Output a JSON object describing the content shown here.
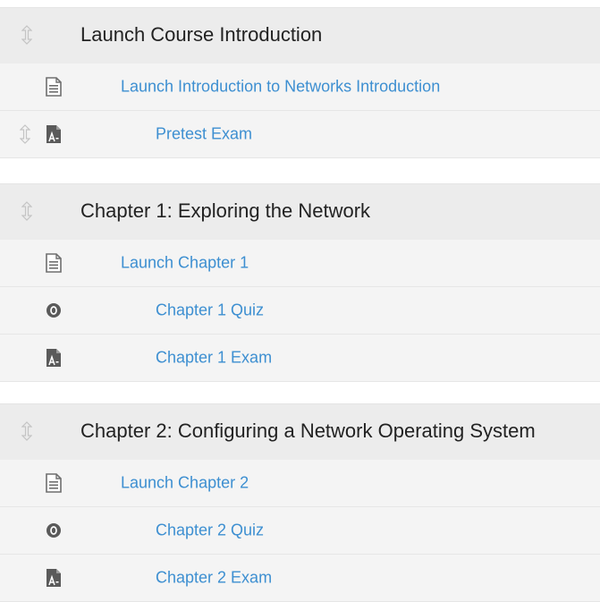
{
  "modules": [
    {
      "title": "Launch Course Introduction",
      "items": [
        {
          "label": "Launch Introduction to Networks Introduction",
          "icon": "document-icon"
        },
        {
          "label": "Pretest Exam",
          "icon": "assessment-icon"
        }
      ]
    },
    {
      "title": "Chapter 1: Exploring the Network",
      "items": [
        {
          "label": "Launch Chapter 1",
          "icon": "document-icon"
        },
        {
          "label": "Chapter 1 Quiz",
          "icon": "quiz-icon"
        },
        {
          "label": "Chapter 1 Exam",
          "icon": "assessment-icon"
        }
      ]
    },
    {
      "title": "Chapter 2: Configuring a Network Operating System",
      "items": [
        {
          "label": "Launch Chapter 2",
          "icon": "document-icon"
        },
        {
          "label": "Chapter 2 Quiz",
          "icon": "quiz-icon"
        },
        {
          "label": "Chapter 2 Exam",
          "icon": "assessment-icon"
        }
      ]
    }
  ],
  "colors": {
    "link": "#3d8fd1",
    "header_bg": "#ececec",
    "item_bg": "#f4f4f4",
    "icon": "#6e6e6e"
  }
}
